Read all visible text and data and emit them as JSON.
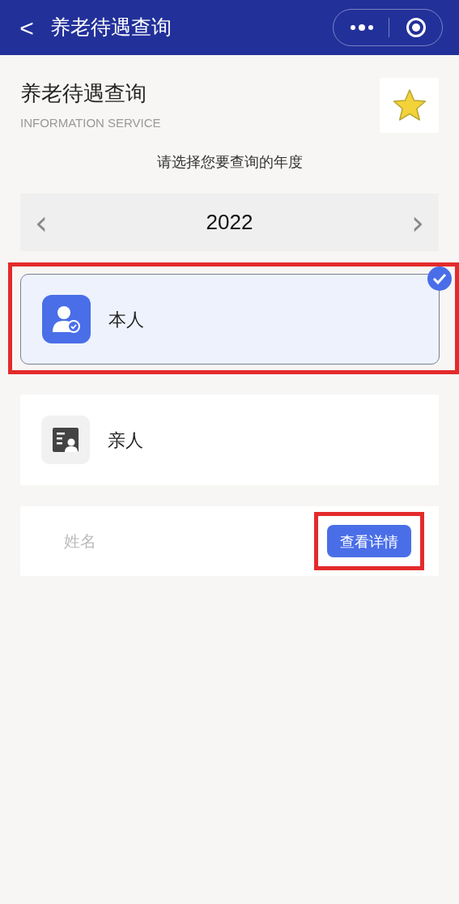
{
  "nav_bar": {
    "back": "<",
    "title": "养老待遇查询"
  },
  "header": {
    "title": "养老待遇查询",
    "subtitle": "INFORMATION SERVICE",
    "favorite": true
  },
  "prompt": "请选择您要查询的年度",
  "year_picker": {
    "prev": "‹",
    "value": "2022",
    "next": "›"
  },
  "options": [
    {
      "kind": "self",
      "label": "本人",
      "selected": true,
      "highlighted": true
    },
    {
      "kind": "relative",
      "label": "亲人",
      "selected": false,
      "highlighted": false
    }
  ],
  "name_row": {
    "label": "姓名",
    "button": "查看详情",
    "button_highlighted": true
  }
}
